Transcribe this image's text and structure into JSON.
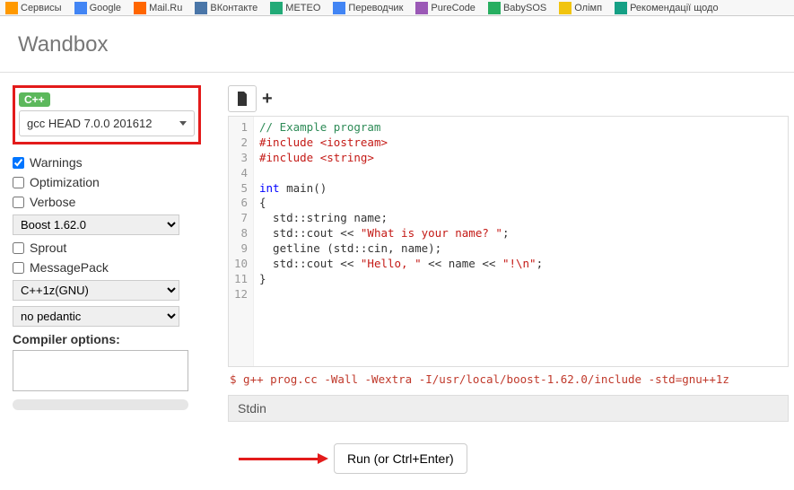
{
  "bookmarks": [
    {
      "label": "Сервисы"
    },
    {
      "label": "Google"
    },
    {
      "label": "Mail.Ru"
    },
    {
      "label": "ВКонтакте"
    },
    {
      "label": "METEO"
    },
    {
      "label": "Переводчик"
    },
    {
      "label": "PureCode"
    },
    {
      "label": "BabySOS"
    },
    {
      "label": "Олімп"
    },
    {
      "label": "Рекомендації щодо"
    }
  ],
  "title": "Wandbox",
  "lang_badge": "C++",
  "compiler": "gcc HEAD 7.0.0 201612",
  "options": {
    "warnings": {
      "label": "Warnings",
      "checked": true
    },
    "optimization": {
      "label": "Optimization",
      "checked": false
    },
    "verbose": {
      "label": "Verbose",
      "checked": false
    },
    "boost": {
      "label": "Boost 1.62.0"
    },
    "sprout": {
      "label": "Sprout",
      "checked": false
    },
    "messagepack": {
      "label": "MessagePack",
      "checked": false
    },
    "std": {
      "label": "C++1z(GNU)"
    },
    "pedantic": {
      "label": "no pedantic"
    },
    "compiler_options_label": "Compiler options:"
  },
  "code_lines": [
    {
      "n": 1,
      "html": "<span class='tok-com'>// Example program</span>"
    },
    {
      "n": 2,
      "html": "<span class='tok-pp'>#include</span> <span class='tok-str'>&lt;iostream&gt;</span>"
    },
    {
      "n": 3,
      "html": "<span class='tok-pp'>#include</span> <span class='tok-str'>&lt;string&gt;</span>"
    },
    {
      "n": 4,
      "html": ""
    },
    {
      "n": 5,
      "html": "<span class='tok-kw'>int</span> main()"
    },
    {
      "n": 6,
      "html": "{"
    },
    {
      "n": 7,
      "html": "  std::string name;"
    },
    {
      "n": 8,
      "html": "  std::cout &lt;&lt; <span class='tok-str'>\"What is your name? \"</span>;"
    },
    {
      "n": 9,
      "html": "  getline (std::cin, name);"
    },
    {
      "n": 10,
      "html": "  std::cout &lt;&lt; <span class='tok-str'>\"Hello, \"</span> &lt;&lt; name &lt;&lt; <span class='tok-str'>\"!\\n\"</span>;"
    },
    {
      "n": 11,
      "html": "}"
    },
    {
      "n": 12,
      "html": ""
    }
  ],
  "command": "$ g++ prog.cc -Wall -Wextra -I/usr/local/boost-1.62.0/include -std=gnu++1z",
  "stdin_label": "Stdin",
  "run_label": "Run (or Ctrl+Enter)"
}
